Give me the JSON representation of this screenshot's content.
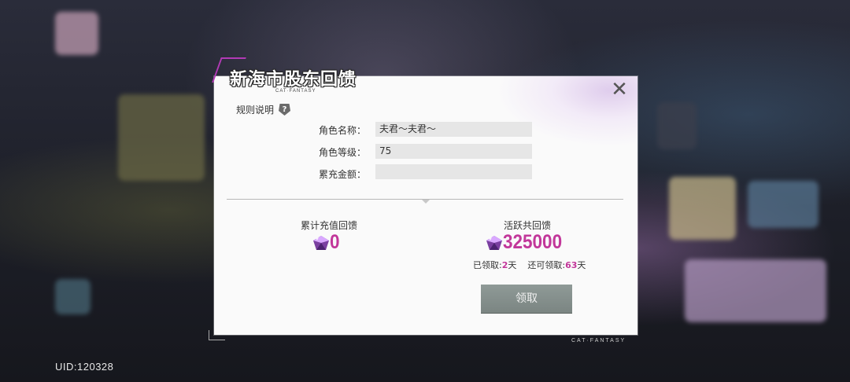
{
  "dialog": {
    "title": "新海市股东回馈",
    "title_sub": "CAT·FANTASY",
    "close_glyph": "✕",
    "rules_label": "规则说明",
    "help_glyph": "?",
    "fields": [
      {
        "label": "角色名称：",
        "value": "夫君～夫君～"
      },
      {
        "label": "角色等级：",
        "value": "75"
      },
      {
        "label": "累充金额：",
        "value": ""
      }
    ],
    "recharge": {
      "label": "累计充值回馈",
      "value": "0"
    },
    "active": {
      "label": "活跃共回馈",
      "value": "325000",
      "claimed_prefix": "已领取:",
      "claimed_days": "2",
      "claimed_unit": "天",
      "remaining_prefix": "还可领取:",
      "remaining_days": "63",
      "remaining_unit": "天"
    },
    "claim_button": "领取"
  },
  "footer": {
    "uid": "UID:120328",
    "brand": "CAT·FANTASY"
  },
  "colors": {
    "accent": "#c2379a",
    "button": "#848e8b",
    "dialog_bg": "#fafafa",
    "field_bg": "#e6e6e6"
  }
}
